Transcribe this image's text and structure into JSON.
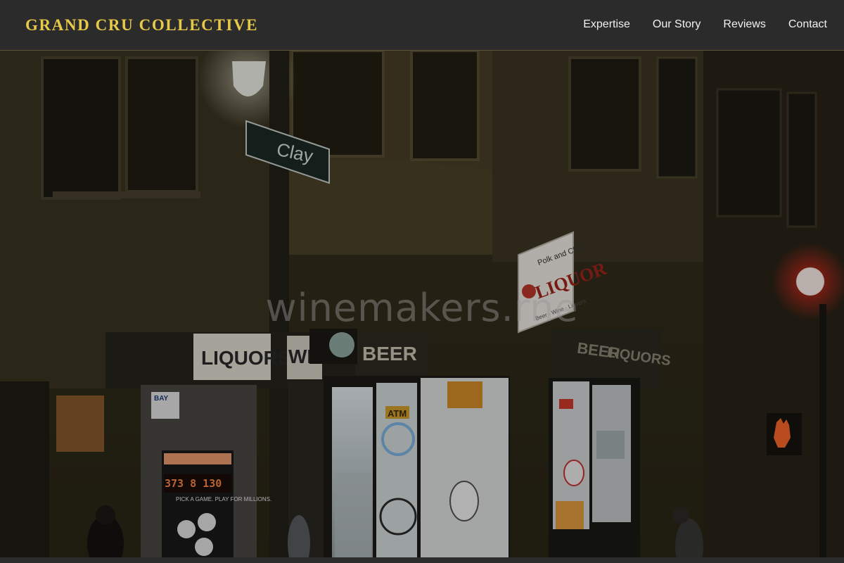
{
  "header": {
    "brand": "GRAND CRU COLLECTIVE",
    "nav": [
      {
        "label": "Expertise"
      },
      {
        "label": "Our Story"
      },
      {
        "label": "Reviews"
      },
      {
        "label": "Contact"
      }
    ]
  },
  "hero": {
    "watermark": "winemakers.rne",
    "street_sign": "Clay",
    "street_sign_small": "Clay",
    "store_sign_top": "Polk and Clay",
    "store_sign_main": "LIQUOR",
    "store_sign_sub": "Beer · Wine · Liquors",
    "awning_left": "LIQUORS",
    "awning_mid_left": "WINE",
    "awning_mid": "BEER",
    "awning_right_1": "BEER",
    "awning_right_2": "LIQUORS",
    "bay_sign": "BAY",
    "lottery_display": "373 8 130",
    "lottery_text": "PICK A GAME. PLAY FOR MILLIONS.",
    "atm_sign": "ATM"
  },
  "colors": {
    "brand_gold": "#e7c94a",
    "header_bg": "#2b2b2b",
    "nav_text": "#f1f1f1",
    "traffic_red": "#ff3a2a"
  }
}
